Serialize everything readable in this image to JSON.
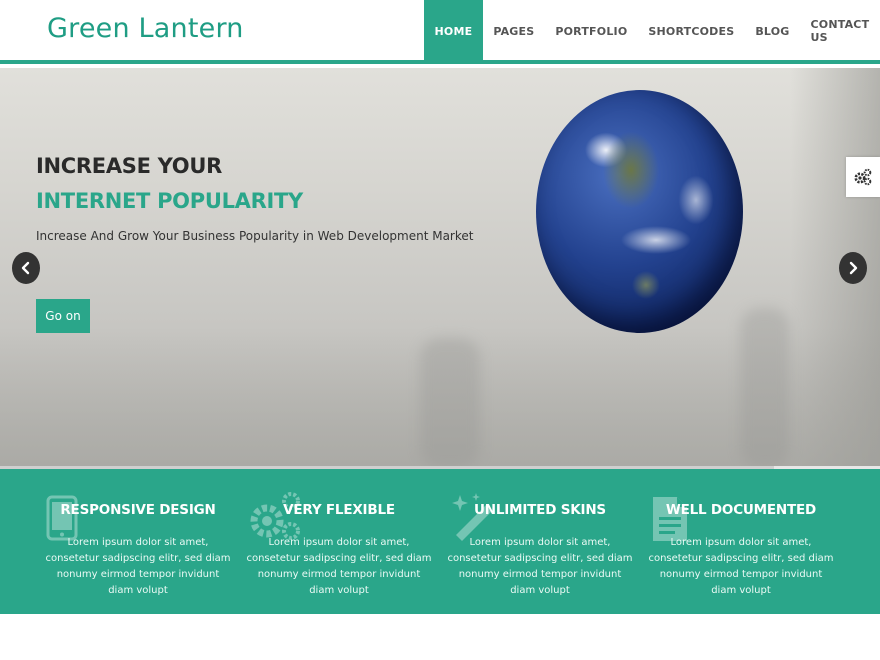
{
  "brand": {
    "logo_text": "Green Lantern",
    "accent_color": "#2aa68a"
  },
  "nav": {
    "items": [
      {
        "label": "HOME",
        "active": true
      },
      {
        "label": "PAGES"
      },
      {
        "label": "PORTFOLIO"
      },
      {
        "label": "SHORTCODES"
      },
      {
        "label": "BLOG"
      },
      {
        "label": "CONTACT US"
      }
    ]
  },
  "hero": {
    "headline_line1": "INCREASE YOUR",
    "headline_line2": "INTERNET POPULARITY",
    "subheading": "Increase And Grow Your Business Popularity in Web Development Market",
    "cta_label": "Go on",
    "image_icon": "earth-globe-image",
    "prev_icon": "chevron-left-icon",
    "next_icon": "chevron-right-icon",
    "settings_icon": "gears-icon",
    "slide_progress": 0.88
  },
  "features": [
    {
      "title": "RESPONSIVE DESIGN",
      "icon": "tablet-icon",
      "description": "Lorem ipsum dolor sit amet, consetetur sadipscing elitr, sed diam nonumy eirmod tempor invidunt diam volupt"
    },
    {
      "title": "VERY FLEXIBLE",
      "icon": "gears-icon",
      "description": "Lorem ipsum dolor sit amet, consetetur sadipscing elitr, sed diam nonumy eirmod tempor invidunt diam volupt"
    },
    {
      "title": "UNLIMITED SKINS",
      "icon": "magic-wand-icon",
      "description": "Lorem ipsum dolor sit amet, consetetur sadipscing elitr, sed diam nonumy eirmod tempor invidunt diam volupt"
    },
    {
      "title": "WELL DOCUMENTED",
      "icon": "document-icon",
      "description": "Lorem ipsum dolor sit amet, consetetur sadipscing elitr, sed diam nonumy eirmod tempor invidunt diam volupt"
    }
  ]
}
